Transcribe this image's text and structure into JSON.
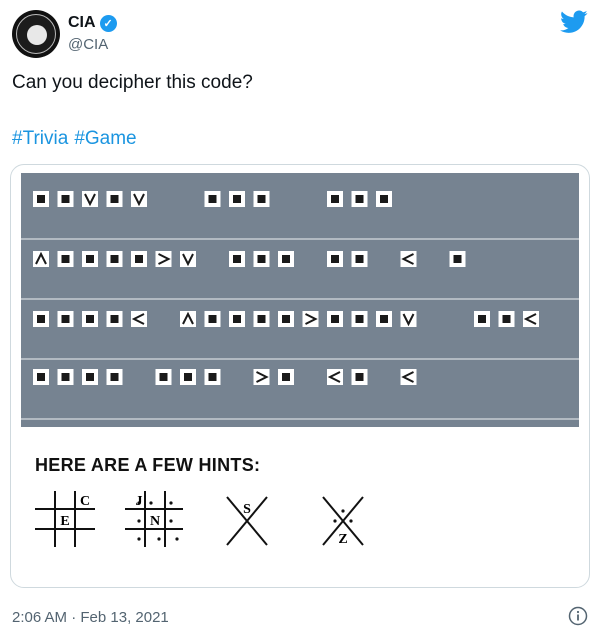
{
  "author": {
    "name": "CIA",
    "handle": "@CIA",
    "verified": true
  },
  "tweet": {
    "text": "Can you decipher this code?",
    "hashtags": [
      "#Trivia",
      "#Game"
    ],
    "timestamp": "2:06 AM · Feb 13, 2021"
  },
  "image": {
    "hints_title": "HERE ARE A FEW HINTS:",
    "hint_letters": [
      "C",
      "E",
      "J",
      "N",
      "S",
      "Z"
    ]
  },
  "colors": {
    "link": "#1b95e0",
    "verified": "#1d9bf0",
    "panel": "#768391"
  }
}
